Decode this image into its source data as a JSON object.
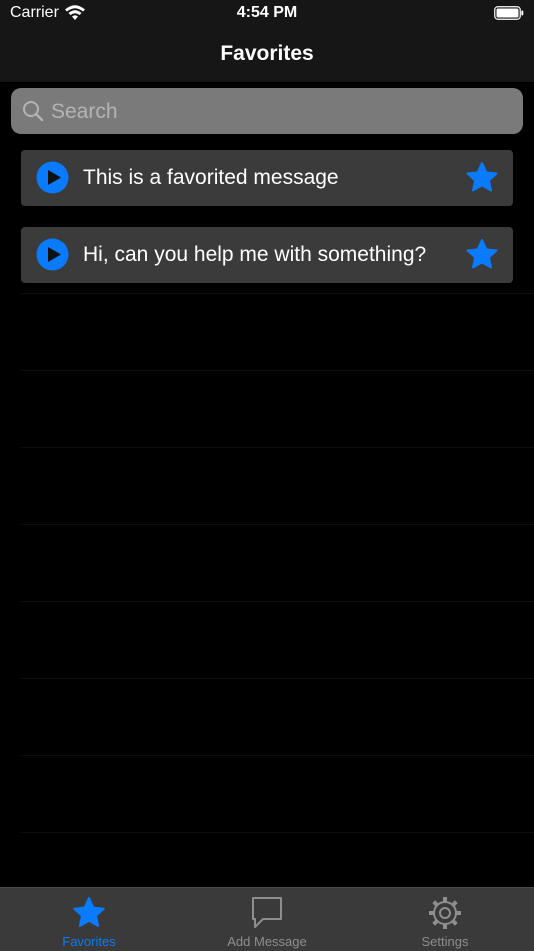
{
  "status_bar": {
    "carrier": "Carrier",
    "time": "4:54 PM"
  },
  "nav": {
    "title": "Favorites"
  },
  "search": {
    "placeholder": "Search",
    "value": ""
  },
  "messages": [
    {
      "text": "This is a favorited message",
      "favorited": true
    },
    {
      "text": "Hi, can you help me with something?",
      "favorited": true
    }
  ],
  "tabs": [
    {
      "label": "Favorites",
      "icon": "star-icon",
      "selected": true
    },
    {
      "label": "Add Message",
      "icon": "speech-bubble-icon",
      "selected": false
    },
    {
      "label": "Settings",
      "icon": "gear-icon",
      "selected": false
    }
  ],
  "colors": {
    "accent": "#0a7aff",
    "inactive": "#8e8e8e",
    "cell": "#3b3b3b",
    "bar": "#161616"
  }
}
